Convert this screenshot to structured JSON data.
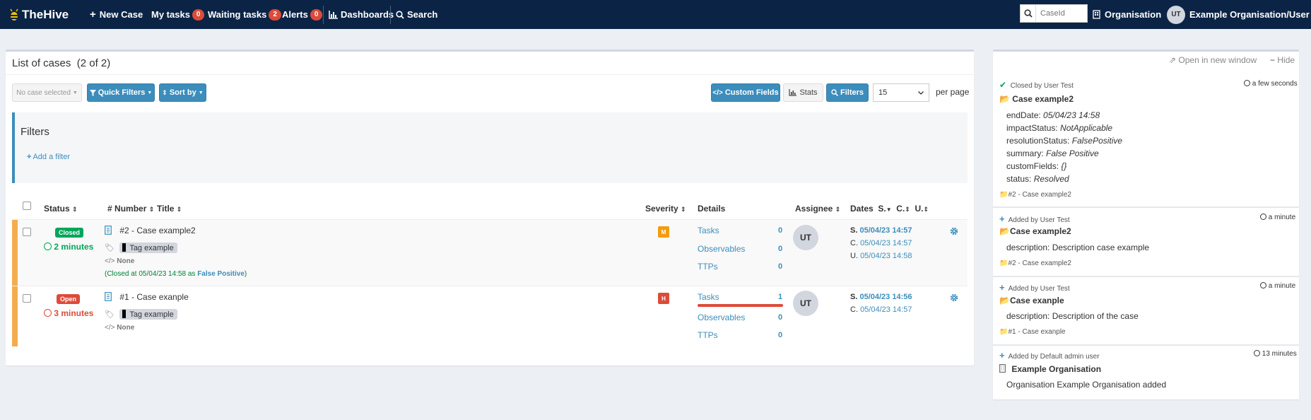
{
  "nav": {
    "brand": "TheHive",
    "new_case": "New Case",
    "my_tasks": "My tasks",
    "my_tasks_count": "0",
    "waiting_tasks": "Waiting tasks",
    "waiting_tasks_count": "2",
    "alerts": "Alerts",
    "alerts_count": "0",
    "dashboards": "Dashboards",
    "search": "Search",
    "caseid_placeholder": "CaseId",
    "organisation": "Organisation",
    "user_initials": "UT",
    "user_label": "Example Organisation/User Test"
  },
  "list": {
    "title": "List of cases",
    "count": "(2 of 2)",
    "no_case_selected": "No case selected",
    "quick_filters": "Quick Filters",
    "sort_by": "Sort by",
    "custom_fields": "Custom Fields",
    "stats": "Stats",
    "filters_btn": "Filters",
    "per_page_value": "15",
    "per_page_label": "per page",
    "filters_title": "Filters",
    "add_filter": "Add a filter"
  },
  "columns": {
    "status": "Status",
    "hash": "#",
    "number": "Number",
    "title": "Title",
    "severity": "Severity",
    "details": "Details",
    "assignee": "Assignee",
    "dates": "Dates",
    "s": "S.",
    "c": "C.",
    "u": "U."
  },
  "cases": [
    {
      "status": "Closed",
      "status_color": "#00a65a",
      "age": "2 minutes",
      "age_color": "#00a65a",
      "title": "#2 - Case example2",
      "tag": "Tag example",
      "none_label": "None",
      "closed_prefix": "(Closed at 05/04/23 14:58 as ",
      "closed_resolution": "False Positive",
      "closed_suffix": ")",
      "severity": "M",
      "severity_color": "#f39c12",
      "tasks_label": "Tasks",
      "tasks": "0",
      "observables_label": "Observables",
      "observables": "0",
      "ttps_label": "TTPs",
      "ttps": "0",
      "assignee": "UT",
      "s_label": "S.",
      "s_date": "05/04/23 14:57",
      "c_label": "C.",
      "c_date": "05/04/23 14:57",
      "u_label": "U.",
      "u_date": "05/04/23 14:58"
    },
    {
      "status": "Open",
      "status_color": "#dd4b39",
      "age": "3 minutes",
      "age_color": "#dd4b39",
      "title": "#1 - Case exanple",
      "tag": "Tag example",
      "none_label": "None",
      "severity": "H",
      "severity_color": "#dd4b39",
      "tasks_label": "Tasks",
      "tasks": "1",
      "tasks_progress": 0,
      "observables_label": "Observables",
      "observables": "0",
      "ttps_label": "TTPs",
      "ttps": "0",
      "assignee": "UT",
      "s_label": "S.",
      "s_date": "05/04/23 14:56",
      "c_label": "C.",
      "c_date": "05/04/23 14:57"
    }
  ],
  "stream": {
    "open_new_window": "Open in new window",
    "hide": "Hide",
    "items": [
      {
        "action": "Closed by User Test",
        "time": "a few seconds",
        "title": "Case example2",
        "fields": [
          {
            "k": "endDate:",
            "v": "05/04/23 14:58"
          },
          {
            "k": "impactStatus:",
            "v": "NotApplicable"
          },
          {
            "k": "resolutionStatus:",
            "v": "FalsePositive"
          },
          {
            "k": "summary:",
            "v": "False Positive"
          },
          {
            "k": "customFields:",
            "v": "{}"
          },
          {
            "k": "status:",
            "v": "Resolved"
          }
        ],
        "ref": "#2 - Case example2"
      },
      {
        "action": "Added by User Test",
        "time": "a minute",
        "title": "Case example2",
        "desc": "description: Description case example",
        "ref": "#2 - Case example2"
      },
      {
        "action": "Added by User Test",
        "time": "a minute",
        "title": "Case exanple",
        "desc": "description: Description of the case",
        "ref": "#1 - Case exanple"
      },
      {
        "action": "Added by Default admin user",
        "time": "13 minutes",
        "title": "Example Organisation",
        "desc": "Organisation Example Organisation added"
      }
    ]
  },
  "colors": {
    "navbar": "#0b2446",
    "primary": "#3c8dbc",
    "warning": "#f3ad4e",
    "success": "#00a65a",
    "danger": "#dd4b39"
  }
}
